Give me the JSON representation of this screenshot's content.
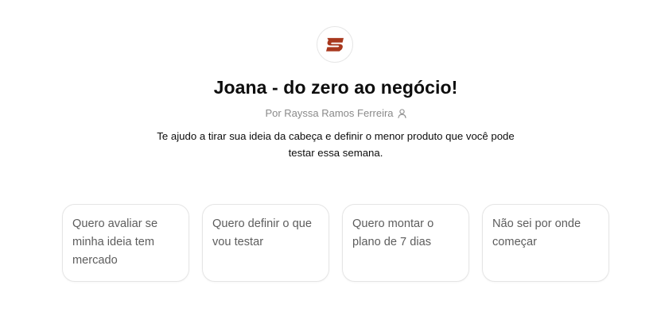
{
  "gpt": {
    "title": "Joana - do zero ao negócio!",
    "byline": "Por Rayssa Ramos Ferreira",
    "description": "Te ajudo a tirar sua ideia da cabeça e definir o menor produto que você pode testar essa semana.",
    "brand_color": "#a8381e"
  },
  "starters": [
    {
      "label": "Quero avaliar se minha ideia tem mercado"
    },
    {
      "label": "Quero definir o que vou testar"
    },
    {
      "label": "Quero montar o plano de 7 dias"
    },
    {
      "label": "Não sei por onde começar"
    }
  ],
  "icons": {
    "avatar": "s-logo-icon",
    "byline": "person-icon"
  }
}
